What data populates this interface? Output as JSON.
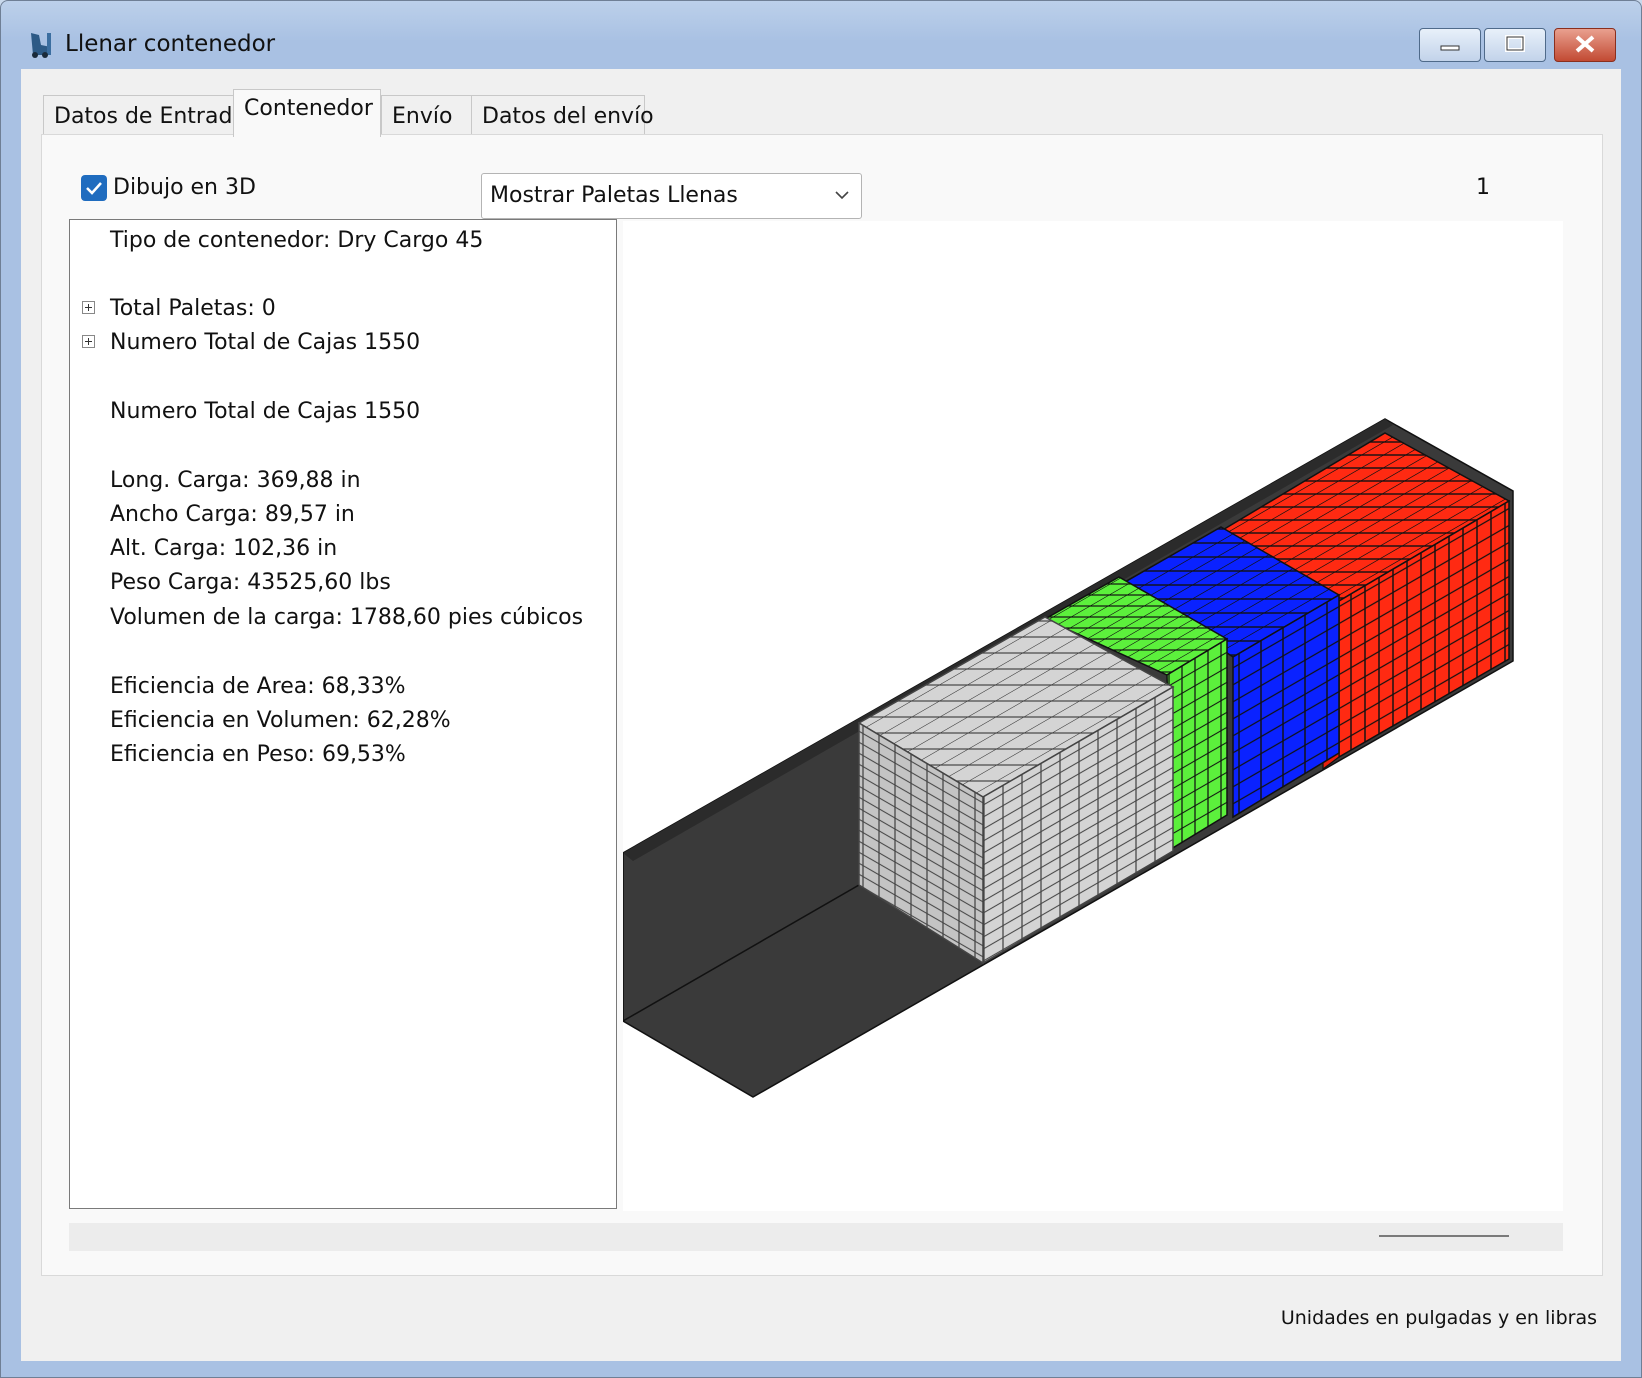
{
  "window": {
    "title": "Llenar contenedor",
    "app_icon": "forklift-icon"
  },
  "tabs": [
    {
      "label": "Datos de Entrada",
      "active": false
    },
    {
      "label": "Contenedor",
      "active": true
    },
    {
      "label": "Envío",
      "active": false
    },
    {
      "label": "Datos del envío",
      "active": false
    }
  ],
  "toolbar": {
    "draw3d_label": "Dibujo en 3D",
    "draw3d_checked": true,
    "view_select_value": "Mostrar Paletas Llenas",
    "page_number": "1"
  },
  "tree": {
    "container_type": "Tipo de contenedor: Dry Cargo 45",
    "total_pallets": "Total Paletas: 0",
    "total_boxes": "Numero Total de Cajas 1550",
    "total_boxes_2": "Numero Total de Cajas 1550",
    "load_length": "Long. Carga: 369,88 in",
    "load_width": "Ancho Carga: 89,57 in",
    "load_height": "Alt. Carga: 102,36 in",
    "load_weight": "Peso Carga: 43525,60 lbs",
    "load_volume": "Volumen de la carga: 1788,60 pies cúbicos",
    "area_eff": "Eficiencia de Area: 68,33%",
    "volume_eff": "Eficiencia en Volumen: 62,28%",
    "weight_eff": "Eficiencia en Peso: 69,53%"
  },
  "footer": {
    "units_note": "Unidades en pulgadas y en libras"
  },
  "colors": {
    "container": "#3a3a3a",
    "gray_boxes": "#d4d4d4",
    "green_boxes": "#5cf03c",
    "blue_boxes": "#0a22ff",
    "red_boxes": "#ff2a12"
  }
}
